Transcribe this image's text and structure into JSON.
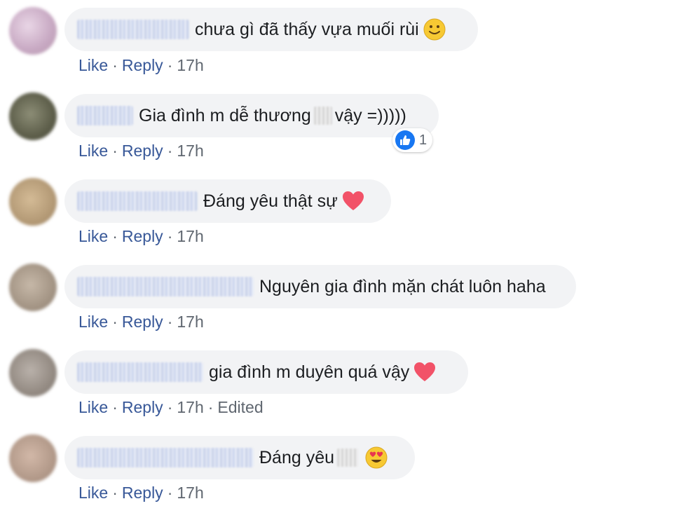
{
  "comments": [
    {
      "text": "chưa gì đã thấy vựa muối rùi",
      "emoji": "slightly-smiling-face",
      "time": "17h"
    },
    {
      "text_before": "Gia đình m dễ thương",
      "text_after": "vậy =)))))",
      "time": "17h",
      "reaction_count": "1"
    },
    {
      "text": "Đáng yêu thật sự",
      "emoji": "heart",
      "time": "17h"
    },
    {
      "text": "Nguyên gia đình mặn chát luôn haha",
      "time": "17h"
    },
    {
      "text": "gia đình m duyên quá vậy",
      "emoji": "heart",
      "time": "17h",
      "edited": "Edited"
    },
    {
      "text": "Đáng yêu",
      "emoji": "heart-eyes-face",
      "time": "17h"
    }
  ],
  "actions": {
    "like": "Like",
    "reply": "Reply",
    "separator": "·"
  },
  "colors": {
    "link": "#385898",
    "bubble": "#f2f3f5",
    "meta": "#606770",
    "like_blue": "#1877f2",
    "heart": "#f25268"
  }
}
